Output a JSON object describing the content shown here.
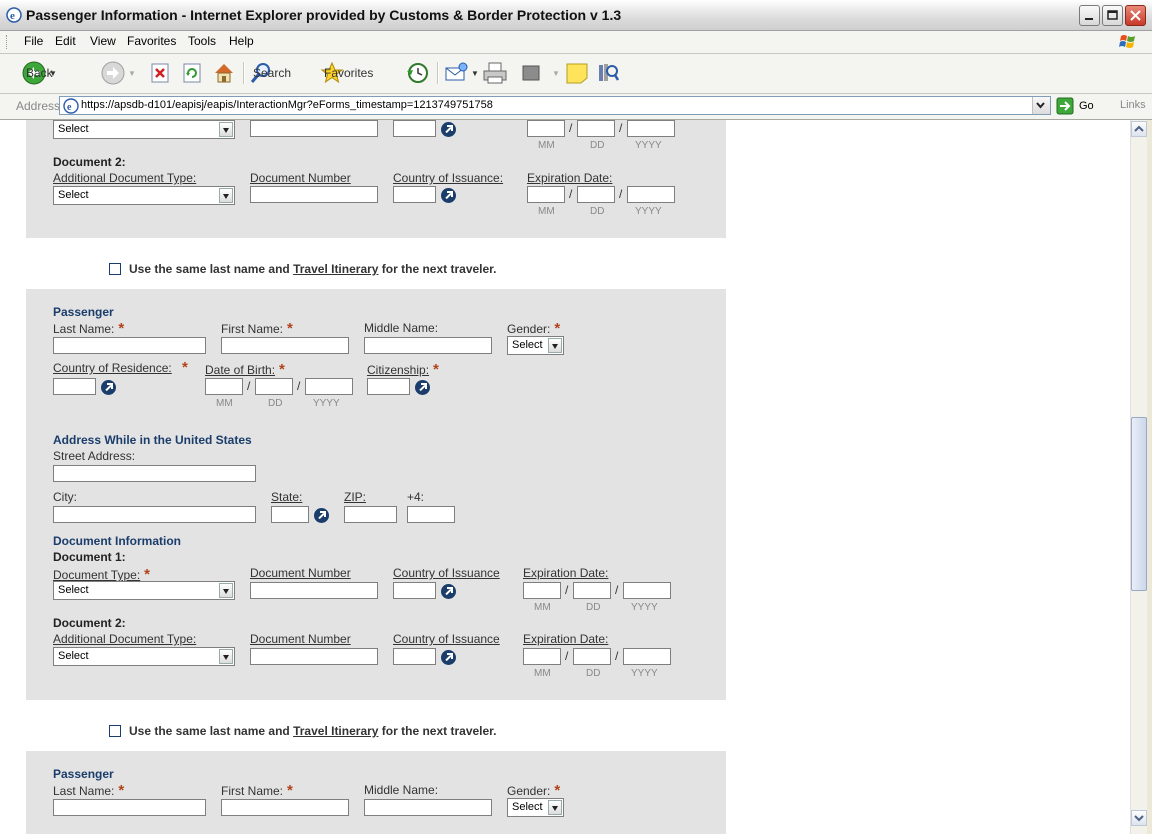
{
  "window": {
    "title": "Passenger Information - Internet Explorer provided by Customs & Border Protection v 1.3"
  },
  "menu": [
    "File",
    "Edit",
    "View",
    "Favorites",
    "Tools",
    "Help"
  ],
  "toolbar": {
    "back": "Back",
    "search": "Search",
    "favorites": "Favorites"
  },
  "address": {
    "label": "Address",
    "url": "https://apsdb-d101/eapisj/eapis/InteractionMgr?eForms_timestamp=1213749751758",
    "go": "Go",
    "links": "Links"
  },
  "form": {
    "select": "Select",
    "mm": "MM",
    "dd": "DD",
    "yyyy": "YYYY",
    "slash": "/",
    "star": "*",
    "document2": "Document 2:",
    "additional_doc_type": "Additional Document Type:",
    "doc_number": "Document Number",
    "country_issuance_colon": "Country of Issuance:",
    "country_issuance": "Country of Issuance",
    "expiration_date": "Expiration Date:",
    "use_same_a": "Use the same last name and ",
    "use_same_link": "Travel Itinerary",
    "use_same_b": " for the next traveler.",
    "passenger": "Passenger",
    "last_name": "Last Name:",
    "first_name": "First Name:",
    "middle_name": "Middle Name:",
    "gender": "Gender:",
    "country_residence": "Country of Residence:",
    "date_of_birth": "Date of Birth:",
    "citizenship": "Citizenship:",
    "address_header": "Address While in the United States",
    "street": "Street Address:",
    "city": "City:",
    "state": "State:",
    "zip": "ZIP:",
    "plus4": "+4:",
    "doc_info": "Document Information",
    "document1": "Document 1:",
    "doc_type": "Document Type:"
  }
}
